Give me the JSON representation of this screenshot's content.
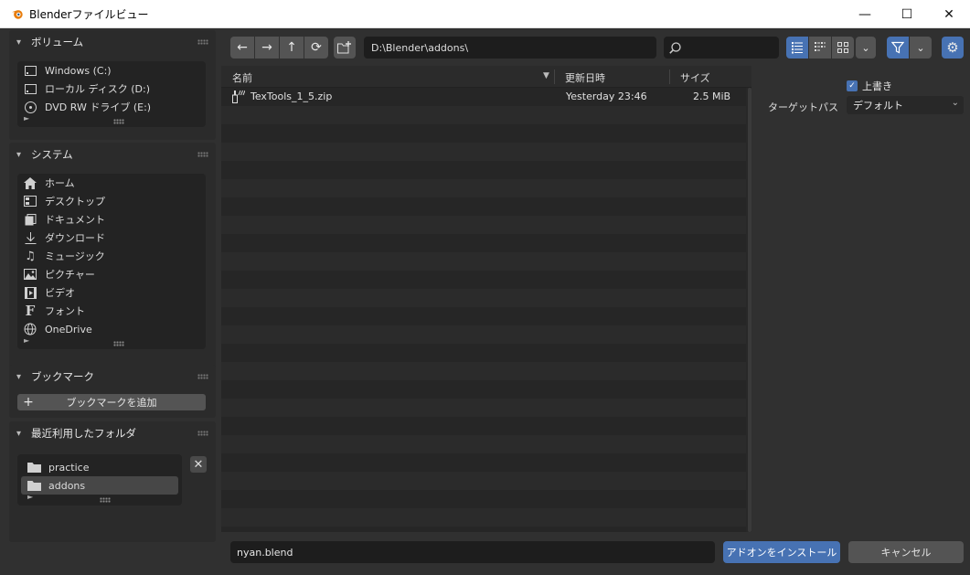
{
  "window": {
    "title": "Blenderファイルビュー",
    "minimize": "—",
    "maximize": "☐",
    "close": "✕"
  },
  "volumes": {
    "header": "ボリューム",
    "items": [
      {
        "label": "Windows (C:)",
        "icon": "drive-icon"
      },
      {
        "label": "ローカル ディスク (D:)",
        "icon": "drive-icon"
      },
      {
        "label": "DVD RW ドライブ (E:)",
        "icon": "disc-icon"
      }
    ]
  },
  "system": {
    "header": "システム",
    "items": [
      {
        "label": "ホーム",
        "icon": "home-icon"
      },
      {
        "label": "デスクトップ",
        "icon": "desktop-icon"
      },
      {
        "label": "ドキュメント",
        "icon": "documents-icon"
      },
      {
        "label": "ダウンロード",
        "icon": "download-icon"
      },
      {
        "label": "ミュージック",
        "icon": "music-icon"
      },
      {
        "label": "ピクチャー",
        "icon": "picture-icon"
      },
      {
        "label": "ビデオ",
        "icon": "video-icon"
      },
      {
        "label": "フォント",
        "icon": "font-icon"
      },
      {
        "label": "OneDrive",
        "icon": "globe-icon"
      }
    ]
  },
  "bookmarks": {
    "header": "ブックマーク",
    "add_label": "ブックマークを追加"
  },
  "recent": {
    "header": "最近利用したフォルダ",
    "items": [
      {
        "label": "practice",
        "icon": "folder-icon",
        "selected": false
      },
      {
        "label": "addons",
        "icon": "folder-icon",
        "selected": true
      }
    ]
  },
  "toolbar": {
    "path": "D:\\Blender\\addons\\",
    "search_placeholder": ""
  },
  "columns": {
    "name": "名前",
    "date": "更新日時",
    "size": "サイズ"
  },
  "files": [
    {
      "name": "TexTools_1_5.zip",
      "date": "Yesterday 23:46",
      "size": "2.5 MiB"
    }
  ],
  "options": {
    "overwrite_label": "上書き",
    "overwrite_checked": true,
    "target_path_label": "ターゲットパス",
    "target_path_value": "デフォルト"
  },
  "bottom": {
    "filename": "nyan.blend",
    "install_label": "アドオンをインストール",
    "cancel_label": "キャンセル"
  },
  "colors": {
    "accent": "#4772b3",
    "background": "#303030"
  }
}
